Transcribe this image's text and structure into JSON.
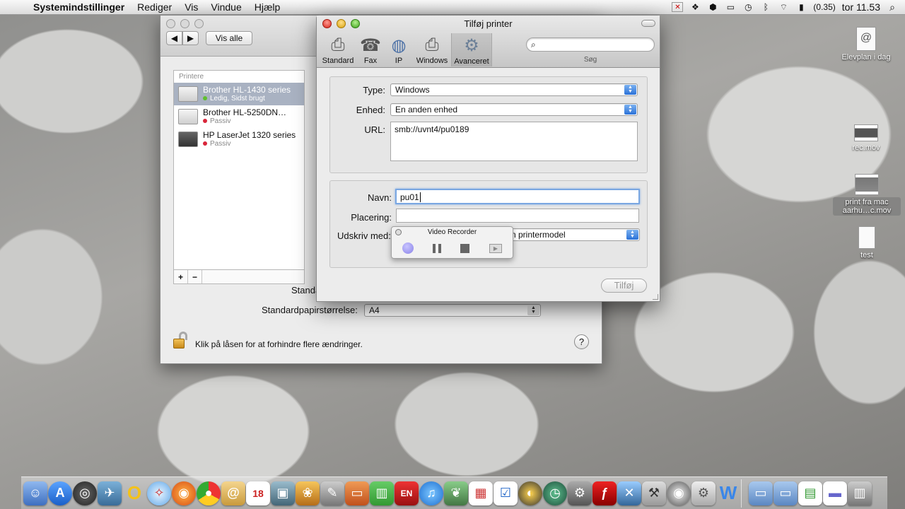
{
  "menubar": {
    "app": "Systemindstillinger",
    "items": [
      "Rediger",
      "Vis",
      "Vindue",
      "Hjælp"
    ],
    "battery": "(0.35)",
    "clock": "tor 11.53"
  },
  "syswin": {
    "show_all": "Vis alle",
    "printers_header": "Printere",
    "printers": [
      {
        "name": "Brother HL-1430 series",
        "status": "Ledig, Sidst brugt"
      },
      {
        "name": "Brother HL-5250DN…",
        "status": "Passiv"
      },
      {
        "name": "HP LaserJet 1320 series",
        "status": "Passiv"
      }
    ],
    "add_symbol": "+",
    "remove_symbol": "−",
    "default_label_partial": "Standa",
    "paper_label": "Standardpapirstørrelse:",
    "paper_value": "A4",
    "lock_text": "Klik på låsen for at forhindre flere ændringer.",
    "help_symbol": "?"
  },
  "addwin": {
    "title": "Tilføj printer",
    "toolbar": [
      "Standard",
      "Fax",
      "IP",
      "Windows",
      "Avanceret"
    ],
    "search_label": "Søg",
    "type_label": "Type:",
    "type_value": "Windows",
    "device_label": "Enhed:",
    "device_value": "En anden enhed",
    "url_label": "URL:",
    "url_value": "smb://uvnt4/pu0189",
    "name_label": "Navn:",
    "name_value": "pu01",
    "location_label": "Placering:",
    "location_value": "",
    "driver_label": "Udskriv med:",
    "driver_value_partial": "n printermodel",
    "add_button": "Tilføj"
  },
  "video_recorder": {
    "title": "Video Recorder"
  },
  "desktop": [
    {
      "label": "Elevplan i dag"
    },
    {
      "label": "rec.mov"
    },
    {
      "label": "print fra mac aarhu…c.mov"
    },
    {
      "label": "test"
    }
  ],
  "colors": {
    "selection": "#a9b2c2",
    "status_green": "#5fbf2e",
    "status_red": "#d9263a",
    "focus": "#7aa7e2"
  }
}
